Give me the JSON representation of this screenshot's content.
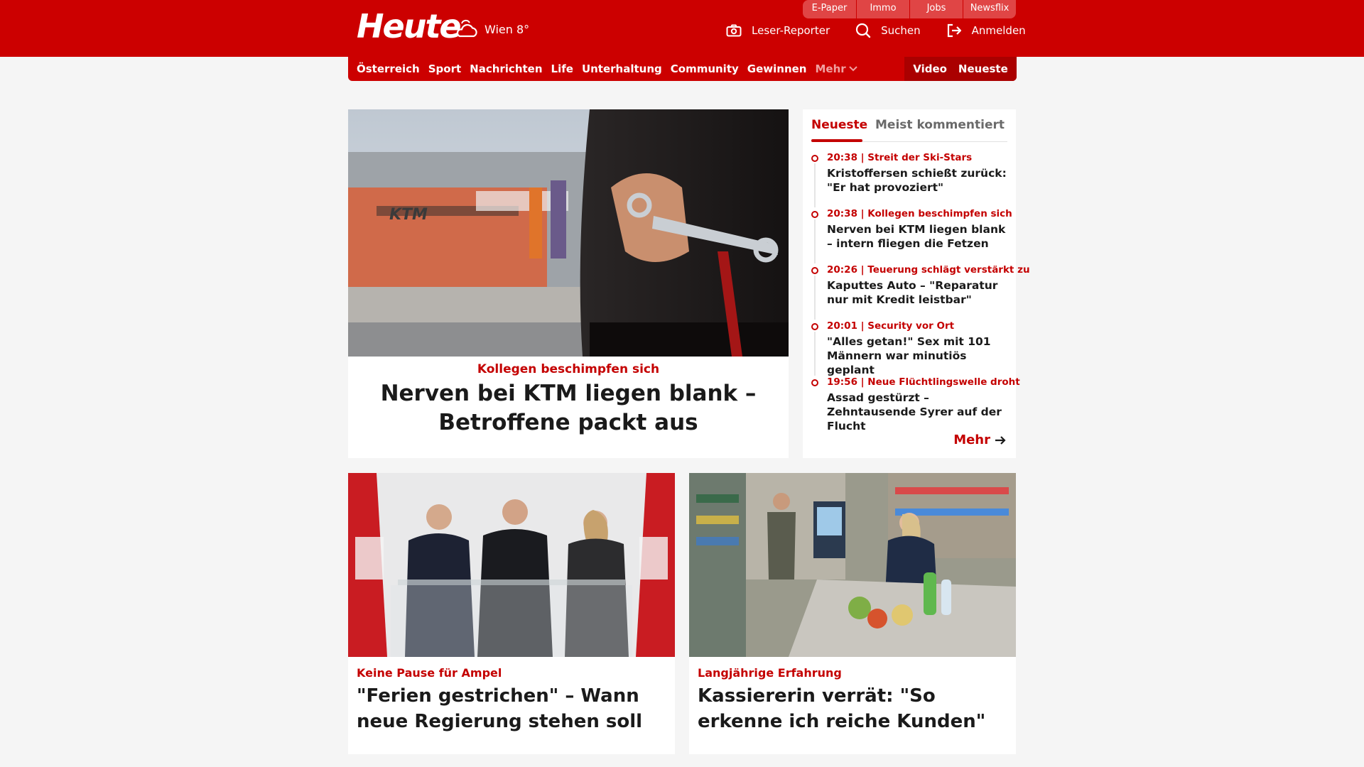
{
  "header": {
    "logo": "Heute",
    "weather": "Wien 8°",
    "utility_links": [
      "E-Paper",
      "Immo",
      "Jobs",
      "Newsflix"
    ],
    "actions": [
      {
        "label": "Leser-Reporter",
        "icon": "camera-icon"
      },
      {
        "label": "Suchen",
        "icon": "search-icon"
      },
      {
        "label": "Anmelden",
        "icon": "login-icon"
      }
    ]
  },
  "nav": {
    "items": [
      "Österreich",
      "Sport",
      "Nachrichten",
      "Life",
      "Unterhaltung",
      "Community",
      "Gewinnen"
    ],
    "more": "Mehr",
    "right": [
      "Video",
      "Neueste"
    ]
  },
  "hero": {
    "kicker": "Kollegen beschimpfen sich",
    "title": "Nerven bei KTM liegen blank – Betroffene packt aus",
    "image": "ktm-building-worker-with-wrench"
  },
  "sidebar": {
    "tabs": [
      "Neueste",
      "Meist kommentiert"
    ],
    "items": [
      {
        "meta": "20:38 | Streit der Ski-Stars",
        "title": "Kristoffersen schießt zurück: \"Er hat provoziert\""
      },
      {
        "meta": "20:38 | Kollegen beschimpfen sich",
        "title": "Nerven bei KTM liegen blank – intern fliegen die Fetzen"
      },
      {
        "meta": "20:26 | Teuerung schlägt verstärkt zu",
        "title": "Kaputtes Auto – \"Reparatur nur mit Kredit leistbar\""
      },
      {
        "meta": "20:01 | Security vor Ort",
        "title": "\"Alles getan!\" Sex mit 101 Männern war minutiös geplant"
      },
      {
        "meta": "19:56 | Neue Flüchtlingswelle droht",
        "title": "Assad gestürzt – Zehntausende Syrer auf der Flucht"
      }
    ],
    "more": "Mehr"
  },
  "cards": [
    {
      "kicker": "Keine Pause für Ampel",
      "title": "\"Ferien gestrichen\" – Wann neue Regierung stehen soll",
      "image": "politicians-press-conference"
    },
    {
      "kicker": "Langjährige Erfahrung",
      "title": "Kassiererin verrät: \"So erkenne ich reiche Kunden\"",
      "image": "supermarket-checkout"
    }
  ],
  "colors": {
    "brand": "#cc0000",
    "accent_text": "#c40000",
    "background": "#f5f5f5"
  }
}
